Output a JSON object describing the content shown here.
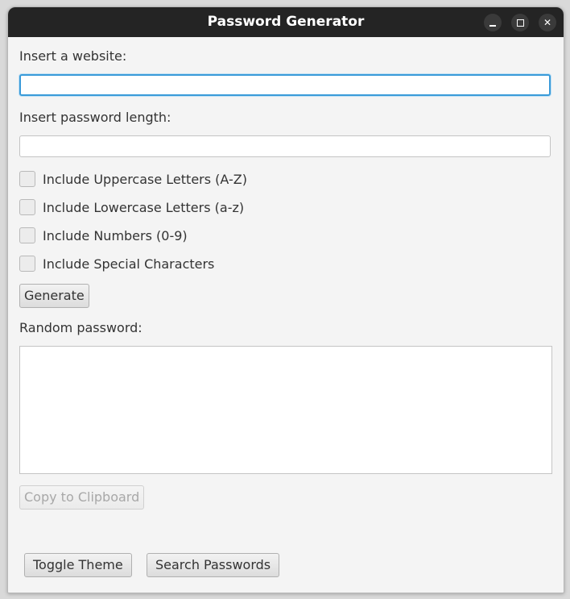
{
  "window": {
    "title": "Password Generator"
  },
  "form": {
    "website_label": "Insert a website:",
    "website_value": "",
    "length_label": "Insert password length:",
    "length_value": "",
    "options": [
      {
        "label": "Include Uppercase Letters (A-Z)",
        "checked": false
      },
      {
        "label": "Include Lowercase Letters (a-z)",
        "checked": false
      },
      {
        "label": "Include Numbers (0-9)",
        "checked": false
      },
      {
        "label": "Include Special Characters",
        "checked": false
      }
    ],
    "generate_label": "Generate",
    "result_label": "Random password:",
    "result_value": "",
    "copy_label": "Copy to Clipboard"
  },
  "footer": {
    "toggle_theme_label": "Toggle Theme",
    "search_label": "Search Passwords"
  },
  "colors": {
    "titlebar": "#242424",
    "background": "#f4f4f4",
    "focus_ring": "#3a9bd9"
  },
  "icons": {
    "minimize": "minimize-icon",
    "maximize": "maximize-icon",
    "close": "close-icon"
  }
}
